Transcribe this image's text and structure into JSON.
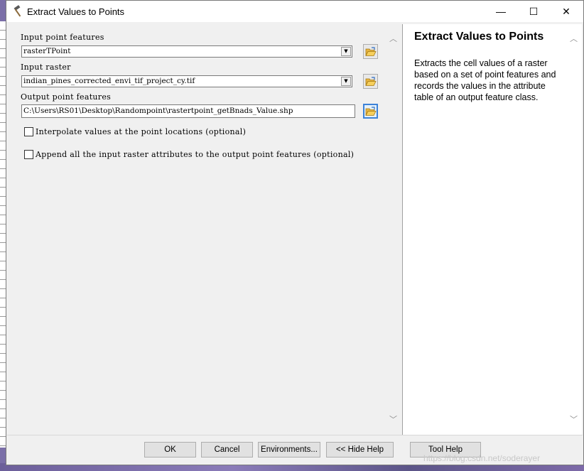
{
  "window": {
    "title": "Extract Values to Points",
    "minimize_glyph": "—",
    "maximize_glyph": "☐",
    "close_glyph": "✕"
  },
  "params": {
    "input_point_features": {
      "label": "Input point features",
      "value": "rasterTPoint"
    },
    "input_raster": {
      "label": "Input raster",
      "value": "indian_pines_corrected_envi_tif_project_cy.tif"
    },
    "output_point_features": {
      "label": "Output point features",
      "value": "C:\\Users\\RS01\\Desktop\\Randompoint\\rastertpoint_getBnads_Value.shp"
    },
    "interpolate": {
      "label": "Interpolate values at the point locations (optional)",
      "checked": false
    },
    "append_attributes": {
      "label": "Append all the input raster attributes to the output point features (optional)",
      "checked": false
    }
  },
  "help": {
    "title": "Extract Values to Points",
    "body": "Extracts the cell values of a raster based on a set of point features and records the values in the attribute table of an output feature class."
  },
  "buttons": {
    "ok": "OK",
    "cancel": "Cancel",
    "environments": "Environments...",
    "hide_help": "<< Hide Help",
    "tool_help": "Tool Help"
  },
  "watermark": "https://blog.csdn.net/soderayer",
  "icons": {
    "title": "hammer-icon",
    "browse": "folder-open-icon"
  },
  "colors": {
    "focus_border": "#3c82d8"
  }
}
